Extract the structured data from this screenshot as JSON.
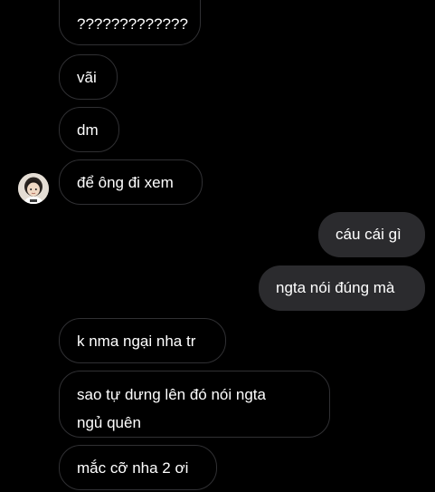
{
  "messages": [
    {
      "direction": "incoming",
      "text": "?????????????"
    },
    {
      "direction": "incoming",
      "text": "vãi"
    },
    {
      "direction": "incoming",
      "text": "dm"
    },
    {
      "direction": "incoming",
      "text": "để ông đi xem"
    },
    {
      "direction": "outgoing",
      "text": "cáu cái gì"
    },
    {
      "direction": "outgoing",
      "text": "ngta nói đúng mà"
    },
    {
      "direction": "incoming",
      "text": "k nma ngại nha tr"
    },
    {
      "direction": "incoming",
      "text_lines": [
        "sao tự dưng lên đó nói ngta",
        "ngủ quên"
      ]
    },
    {
      "direction": "incoming",
      "text": "mắc cỡ nha 2 ơi"
    }
  ],
  "colors": {
    "background": "#000000",
    "incoming_border": "#303033",
    "outgoing_fill": "#2b2b2e",
    "text": "#ffffff"
  },
  "avatar": {
    "icon": "contact-avatar"
  }
}
